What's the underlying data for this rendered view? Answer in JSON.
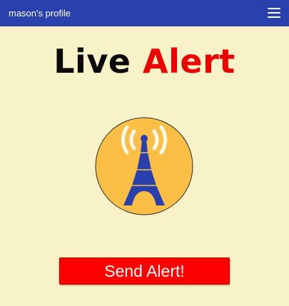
{
  "header": {
    "profile_label": "mason's profile",
    "menu_icon": "hamburger-menu-icon",
    "background_color": "#2941ad"
  },
  "title": {
    "word1": "Live",
    "word2": "Alert",
    "word1_color": "#0a0a0a",
    "word2_color": "#ee0000"
  },
  "emblem": {
    "icon": "broadcast-tower-icon",
    "circle_color": "#fbbf45",
    "tower_color": "#2a3fae"
  },
  "action": {
    "send_label": "Send Alert!",
    "button_color": "#ff0000"
  },
  "page": {
    "background_color": "#f8f2c9"
  }
}
